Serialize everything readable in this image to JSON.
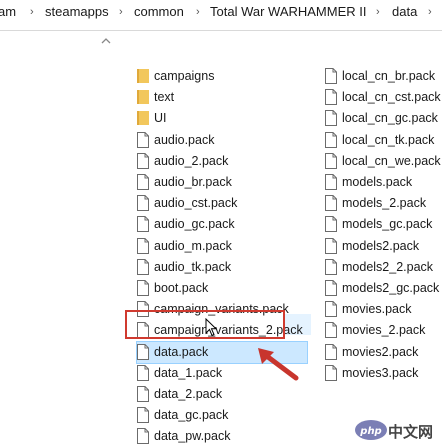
{
  "breadcrumb": {
    "segments": [
      "am",
      "steamapps",
      "common",
      "Total War WARHAMMER II",
      "data"
    ],
    "separator": "›"
  },
  "files": {
    "column1": [
      {
        "name": "campaigns",
        "type": "folder"
      },
      {
        "name": "text",
        "type": "folder"
      },
      {
        "name": "UI",
        "type": "folder"
      },
      {
        "name": "audio.pack",
        "type": "file"
      },
      {
        "name": "audio_2.pack",
        "type": "file"
      },
      {
        "name": "audio_br.pack",
        "type": "file"
      },
      {
        "name": "audio_cst.pack",
        "type": "file"
      },
      {
        "name": "audio_gc.pack",
        "type": "file"
      },
      {
        "name": "audio_m.pack",
        "type": "file"
      },
      {
        "name": "audio_tk.pack",
        "type": "file"
      },
      {
        "name": "boot.pack",
        "type": "file"
      },
      {
        "name": "campaign_variants.pack",
        "type": "file"
      },
      {
        "name": "campaign_variants_2.pack",
        "type": "file"
      },
      {
        "name": "data.pack",
        "type": "file",
        "selected": true
      },
      {
        "name": "data_1.pack",
        "type": "file"
      },
      {
        "name": "data_2.pack",
        "type": "file"
      },
      {
        "name": "data_gc.pack",
        "type": "file"
      },
      {
        "name": "data_pw.pack",
        "type": "file"
      }
    ],
    "column2": [
      {
        "name": "local_cn_br.pack",
        "type": "file"
      },
      {
        "name": "local_cn_cst.pack",
        "type": "file"
      },
      {
        "name": "local_cn_gc.pack",
        "type": "file"
      },
      {
        "name": "local_cn_tk.pack",
        "type": "file"
      },
      {
        "name": "local_cn_we.pack",
        "type": "file"
      },
      {
        "name": "models.pack",
        "type": "file"
      },
      {
        "name": "models_2.pack",
        "type": "file"
      },
      {
        "name": "models_gc.pack",
        "type": "file"
      },
      {
        "name": "models2.pack",
        "type": "file"
      },
      {
        "name": "models2_2.pack",
        "type": "file"
      },
      {
        "name": "models2_gc.pack",
        "type": "file"
      },
      {
        "name": "movies.pack",
        "type": "file"
      },
      {
        "name": "movies_2.pack",
        "type": "file"
      },
      {
        "name": "movies2.pack",
        "type": "file"
      },
      {
        "name": "movies3.pack",
        "type": "file"
      }
    ]
  },
  "annotation": {
    "highlight_color": "#d03a2f",
    "target": "data.pack"
  },
  "watermark": {
    "text": "中文网",
    "logo": "php",
    "logo_color": "#7b7fb5"
  },
  "colors": {
    "folder": "#f2c75c",
    "selection": "#cce8ff",
    "selection_border": "#99d1ff"
  }
}
